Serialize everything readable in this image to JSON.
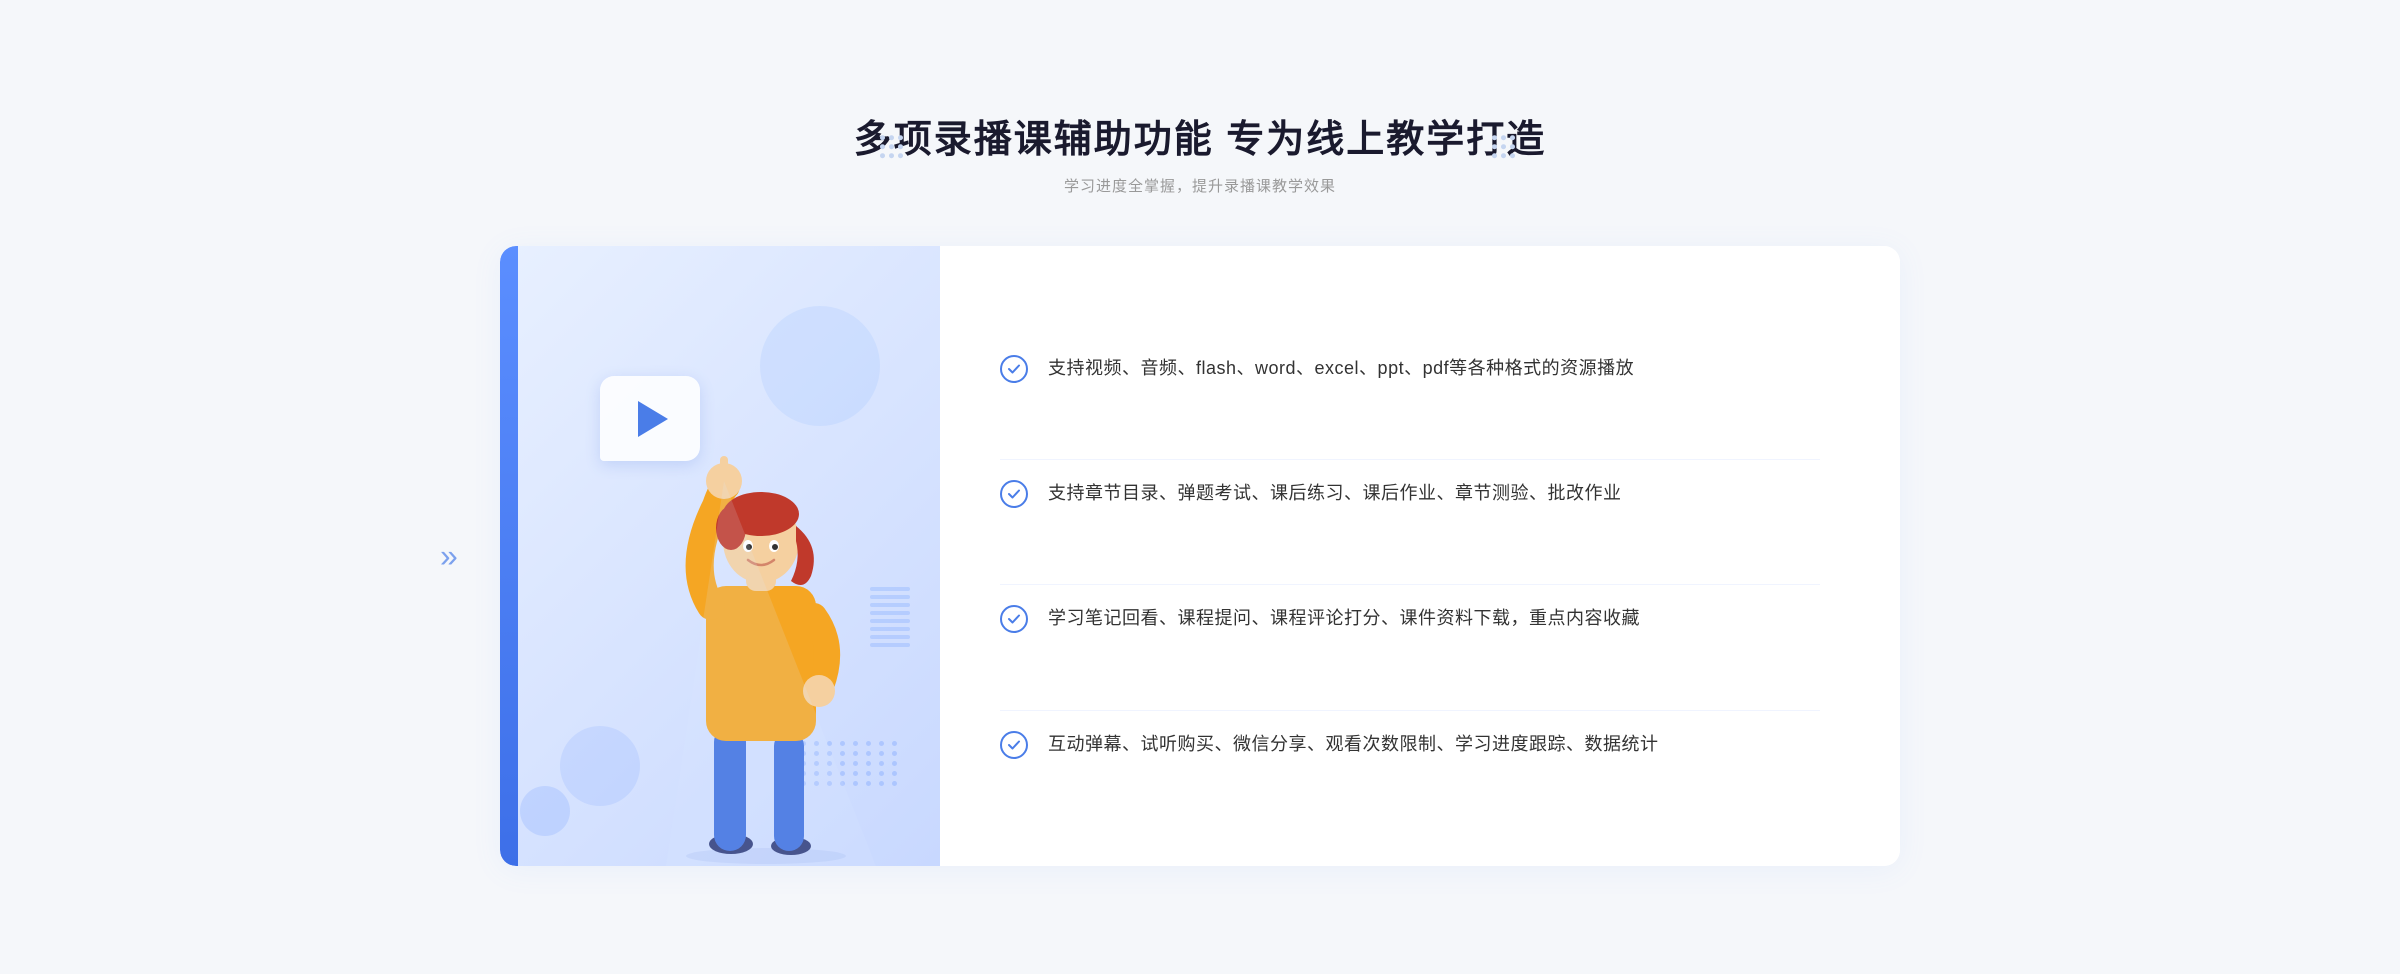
{
  "header": {
    "title": "多项录播课辅助功能 专为线上教学打造",
    "subtitle": "学习进度全掌握，提升录播课教学效果"
  },
  "features": [
    {
      "id": "feature-1",
      "text": "支持视频、音频、flash、word、excel、ppt、pdf等各种格式的资源播放"
    },
    {
      "id": "feature-2",
      "text": "支持章节目录、弹题考试、课后练习、课后作业、章节测验、批改作业"
    },
    {
      "id": "feature-3",
      "text": "学习笔记回看、课程提问、课程评论打分、课件资料下载，重点内容收藏"
    },
    {
      "id": "feature-4",
      "text": "互动弹幕、试听购买、微信分享、观看次数限制、学习进度跟踪、数据统计"
    }
  ],
  "icons": {
    "check": "check-icon",
    "dots_left": "decoration-dots-left",
    "dots_right": "decoration-dots-right",
    "chevron": "chevron-left-icon"
  },
  "colors": {
    "blue_primary": "#4a7de8",
    "blue_light": "#e8f0ff",
    "text_dark": "#1a1a2e",
    "text_gray": "#999999",
    "text_body": "#333333"
  }
}
